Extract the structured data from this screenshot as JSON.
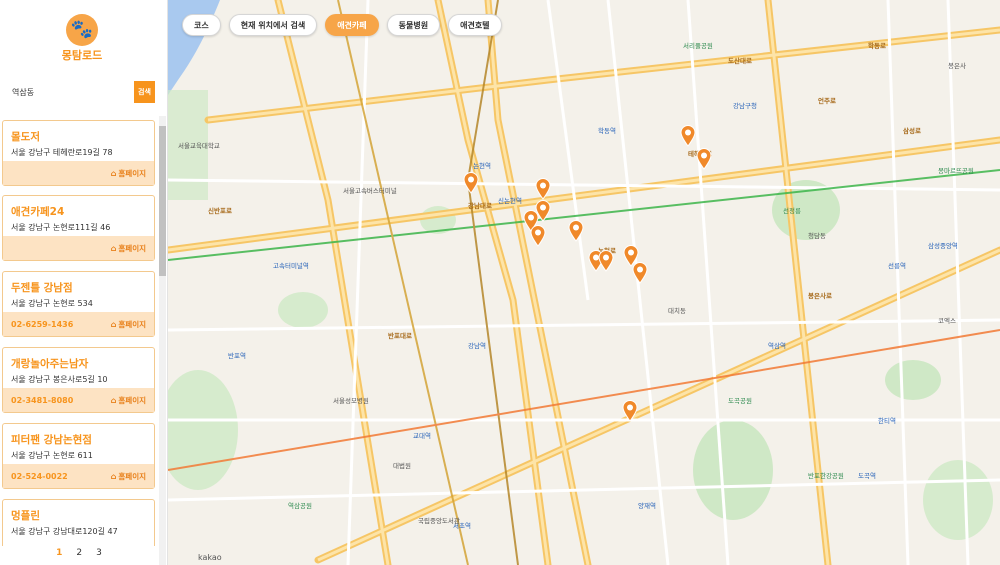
{
  "app": {
    "logo_text": "몽탐로드"
  },
  "search": {
    "value": "역삼동",
    "button": "검색"
  },
  "list": [
    {
      "name": "몰도저",
      "address": "서울 강남구 테헤란로19길 78",
      "phone": "",
      "homepage": "홈페이지"
    },
    {
      "name": "애견카페24",
      "address": "서울 강남구 논현로111길 46",
      "phone": "",
      "homepage": "홈페이지"
    },
    {
      "name": "두젠틀 강남점",
      "address": "서울 강남구 논현로 534",
      "phone": "02-6259-1436",
      "homepage": "홈페이지"
    },
    {
      "name": "개랑놀아주는남자",
      "address": "서울 강남구 봉은사로5길 10",
      "phone": "02-3481-8080",
      "homepage": "홈페이지"
    },
    {
      "name": "피터팬 강남논현점",
      "address": "서울 강남구 논현로 611",
      "phone": "02-524-0022",
      "homepage": "홈페이지"
    },
    {
      "name": "멍플린",
      "address": "서울 강남구 강남대로120길 47",
      "phone": "",
      "homepage": ""
    }
  ],
  "pagination": {
    "pages": [
      "1",
      "2",
      "3"
    ],
    "active": "1"
  },
  "tabs": [
    {
      "label": "코스",
      "active": false
    },
    {
      "label": "현재 위치에서 검색",
      "active": false
    },
    {
      "label": "애견카페",
      "active": true
    },
    {
      "label": "동물병원",
      "active": false
    },
    {
      "label": "애견호텔",
      "active": false
    }
  ],
  "map": {
    "labels": [
      {
        "text": "신반포로",
        "kind": "road"
      },
      {
        "text": "강남대로",
        "kind": "road"
      },
      {
        "text": "테헤란로",
        "kind": "road"
      },
      {
        "text": "논현로",
        "kind": "road"
      },
      {
        "text": "언주로",
        "kind": "road"
      },
      {
        "text": "봉은사로",
        "kind": "road"
      },
      {
        "text": "도산대로",
        "kind": "road"
      },
      {
        "text": "학동로",
        "kind": "road"
      },
      {
        "text": "반포대로",
        "kind": "road"
      },
      {
        "text": "삼성로",
        "kind": "road"
      },
      {
        "text": "강남구청",
        "kind": "blue"
      },
      {
        "text": "선정릉",
        "kind": "green"
      },
      {
        "text": "신논현역",
        "kind": "blue"
      },
      {
        "text": "논현역",
        "kind": "blue"
      },
      {
        "text": "학동역",
        "kind": "blue"
      },
      {
        "text": "강남역",
        "kind": "blue"
      },
      {
        "text": "역삼역",
        "kind": "blue"
      },
      {
        "text": "선릉역",
        "kind": "blue"
      },
      {
        "text": "서초역",
        "kind": "blue"
      },
      {
        "text": "교대역",
        "kind": "blue"
      },
      {
        "text": "고속터미널역",
        "kind": "blue"
      },
      {
        "text": "반포역",
        "kind": "blue"
      },
      {
        "text": "삼성중앙역",
        "kind": "blue"
      },
      {
        "text": "한티역",
        "kind": "blue"
      },
      {
        "text": "도곡역",
        "kind": "blue"
      },
      {
        "text": "양재역",
        "kind": "blue"
      },
      {
        "text": "서울고속버스터미널",
        "kind": "plain"
      },
      {
        "text": "서울성모병원",
        "kind": "plain"
      },
      {
        "text": "국립중앙도서관",
        "kind": "plain"
      },
      {
        "text": "대법원",
        "kind": "plain"
      },
      {
        "text": "서울교육대학교",
        "kind": "plain"
      },
      {
        "text": "반포한강공원",
        "kind": "green"
      },
      {
        "text": "도곡공원",
        "kind": "green"
      },
      {
        "text": "역삼공원",
        "kind": "green"
      },
      {
        "text": "서리풀공원",
        "kind": "green"
      },
      {
        "text": "몽마르뜨공원",
        "kind": "green"
      },
      {
        "text": "봉은사",
        "kind": "plain"
      },
      {
        "text": "코엑스",
        "kind": "plain"
      },
      {
        "text": "청담동",
        "kind": "plain"
      },
      {
        "text": "대치동",
        "kind": "plain"
      }
    ],
    "attribution": "kakao"
  }
}
